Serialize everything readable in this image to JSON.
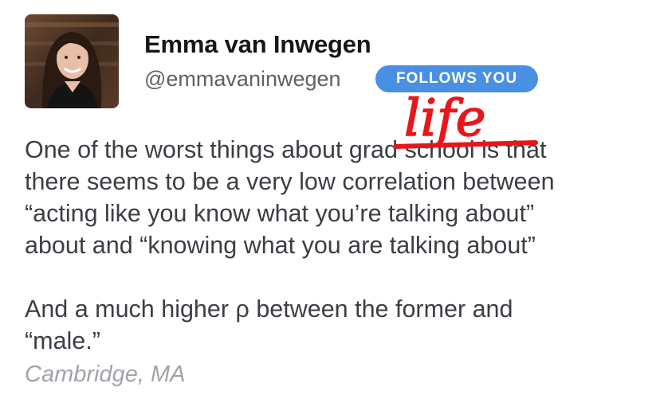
{
  "user": {
    "display_name": "Emma van Inwegen",
    "handle": "@emmavaninwegen",
    "follows_badge": "FOLLOWS YOU"
  },
  "tweet": {
    "line1_before": "One of the worst things about ",
    "line1_struck": "grad school",
    "line1_after": " is that",
    "line2": "there seems to be a very low correlation between",
    "line3": "“acting like you know what you’re talking about”",
    "line4": "about and “knowing what you are talking about”",
    "line5": "And a much higher ρ between the former and",
    "line6": "“male.”"
  },
  "handwritten_correction": "life",
  "location": "Cambridge, MA",
  "colors": {
    "accent_badge": "#4a90e2",
    "annotation_red": "#e8161b",
    "name_text": "#14171a",
    "body_text": "#3b3f44",
    "muted_text": "#a0a4a9"
  },
  "icons": {
    "avatar": "profile-photo"
  }
}
